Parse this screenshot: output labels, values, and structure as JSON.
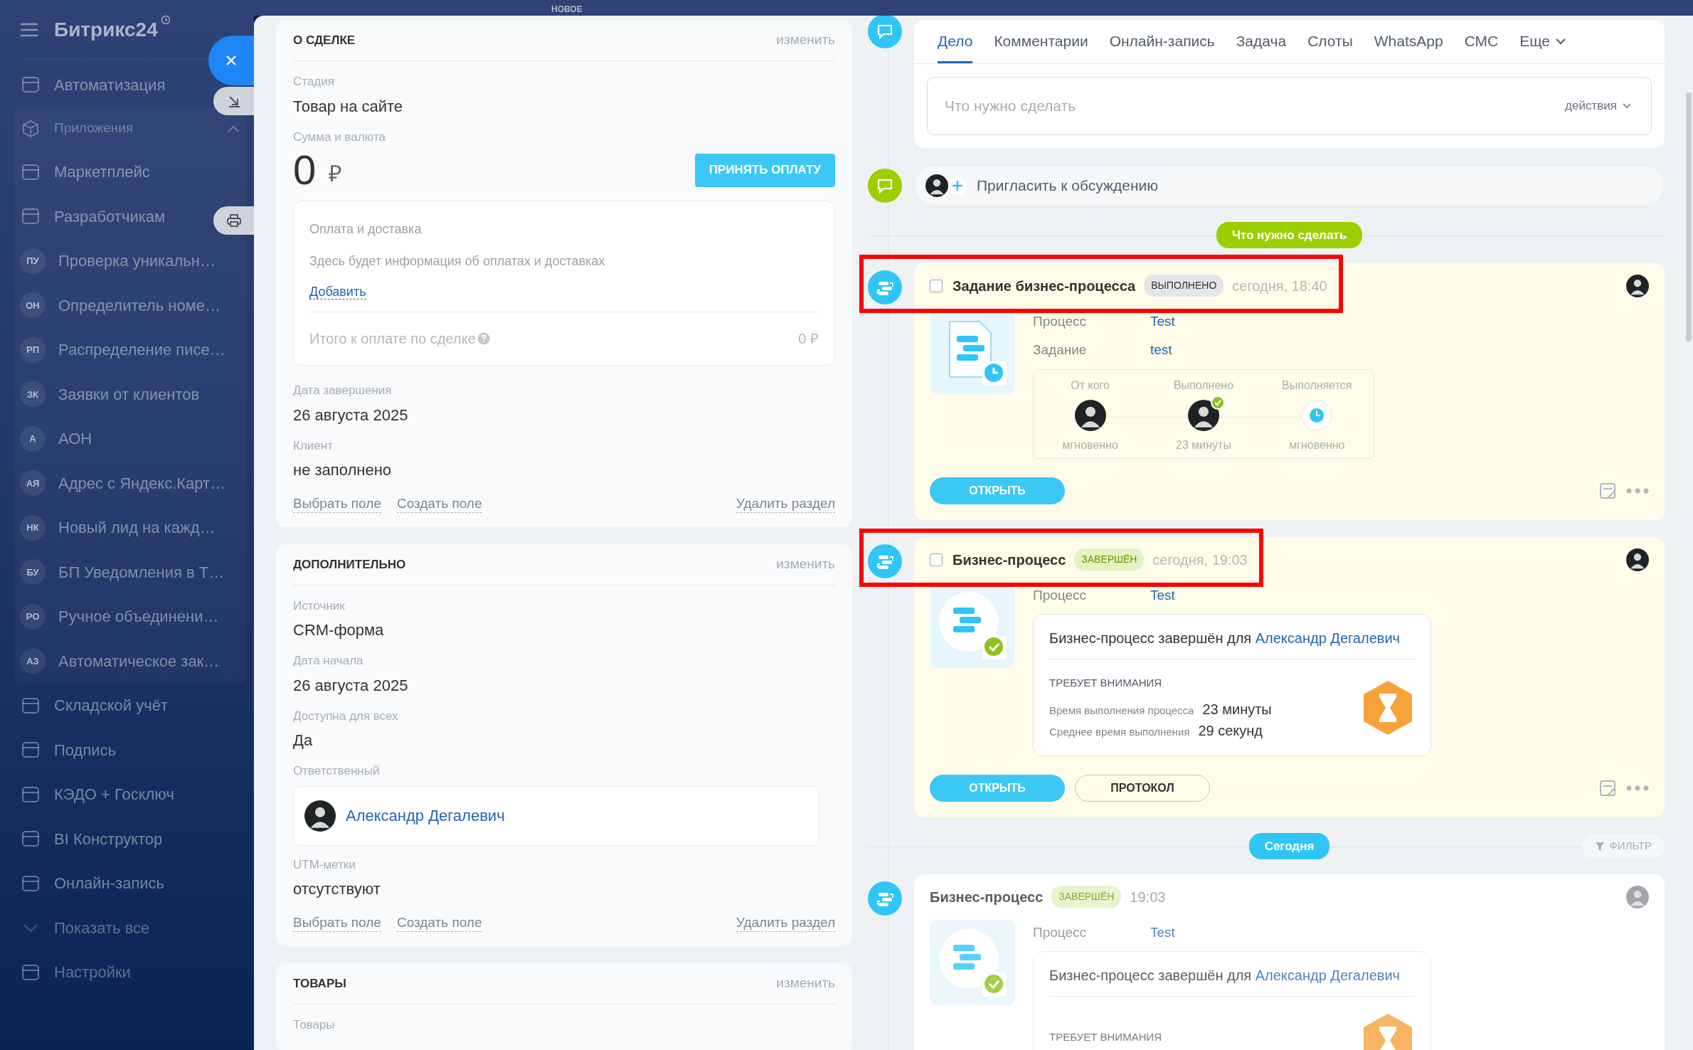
{
  "sidebar": {
    "logo": "Битрикс24",
    "items": [
      {
        "kind": "icon",
        "label": "Автоматизация"
      },
      {
        "kind": "group",
        "label": "Приложения",
        "expanded": true,
        "children": [
          {
            "kind": "icon",
            "label": "Маркетплейс"
          },
          {
            "kind": "icon",
            "label": "Разработчикам"
          },
          {
            "kind": "initials",
            "initials": "ПУ",
            "label": "Проверка уникальн…"
          },
          {
            "kind": "initials",
            "initials": "ОН",
            "label": "Определитель номе…"
          },
          {
            "kind": "initials",
            "initials": "РП",
            "label": "Распределение писе…"
          },
          {
            "kind": "initials",
            "initials": "ЗК",
            "label": "Заявки от клиентов"
          },
          {
            "kind": "initials",
            "initials": "А",
            "label": "АОН"
          },
          {
            "kind": "initials",
            "initials": "АЯ",
            "label": "Адрес с Яндекс.Карт…"
          },
          {
            "kind": "initials",
            "initials": "НК",
            "label": "Новый лид на кажд…"
          },
          {
            "kind": "initials",
            "initials": "БУ",
            "label": "БП Уведомления в Т…"
          },
          {
            "kind": "initials",
            "initials": "РО",
            "label": "Ручное объединени…"
          },
          {
            "kind": "initials",
            "initials": "АЗ",
            "label": "Автоматическое зак…"
          }
        ]
      },
      {
        "kind": "icon",
        "label": "Складской учёт"
      },
      {
        "kind": "icon",
        "label": "Подпись"
      },
      {
        "kind": "icon",
        "label": "КЭДО + Госключ"
      },
      {
        "kind": "icon",
        "label": "BI Конструктор"
      },
      {
        "kind": "icon",
        "label": "Онлайн-запись"
      },
      {
        "kind": "more",
        "label": "Показать все"
      },
      {
        "kind": "icon",
        "label": "Настройки"
      }
    ]
  },
  "top_bar": {
    "label": "НОВОЕ"
  },
  "sections": [
    {
      "title": "О СДЕЛКЕ",
      "edit": "изменить",
      "fields": [
        {
          "kind": "text",
          "label": "Стадия",
          "value": "Товар на сайте"
        },
        {
          "kind": "money",
          "label": "Сумма и валюта",
          "amount": "0",
          "currency": "₽",
          "button": "ПРИНЯТЬ ОПЛАТУ"
        },
        {
          "kind": "payment",
          "title": "Оплата и доставка",
          "text": "Здесь будет информация об оплатах и доставках",
          "link": "Добавить",
          "total_label": "Итого к оплате по сделке",
          "total": "0 ₽"
        },
        {
          "kind": "text",
          "label": "Дата завершения",
          "value": "26 августа 2025"
        },
        {
          "kind": "text",
          "label": "Клиент",
          "value": "не заполнено"
        }
      ],
      "actions": [
        "Выбрать поле",
        "Создать поле"
      ],
      "delete": "Удалить раздел"
    },
    {
      "title": "ДОПОЛНИТЕЛЬНО",
      "edit": "изменить",
      "fields": [
        {
          "kind": "text",
          "label": "Источник",
          "value": "CRM-форма"
        },
        {
          "kind": "text",
          "label": "Дата начала",
          "value": "26 августа 2025"
        },
        {
          "kind": "text",
          "label": "Доступна для всех",
          "value": "Да"
        },
        {
          "kind": "person",
          "label": "Ответственный",
          "value": "Александр Дегалевич"
        },
        {
          "kind": "text",
          "label": "UTM-метки",
          "value": "отсутствуют"
        }
      ],
      "actions": [
        "Выбрать поле",
        "Создать поле"
      ],
      "delete": "Удалить раздел"
    },
    {
      "title": "ТОВАРЫ",
      "edit": "изменить",
      "fields": [
        {
          "kind": "text",
          "label": "Товары"
        }
      ]
    }
  ],
  "timeline": {
    "tabs": [
      {
        "label": "Дело",
        "selected": true
      },
      {
        "label": "Комментарии",
        "selected": false
      },
      {
        "label": "Онлайн-запись",
        "selected": false
      },
      {
        "label": "Задача",
        "selected": false
      },
      {
        "label": "Слоты",
        "selected": false
      },
      {
        "label": "WhatsApp",
        "selected": false
      },
      {
        "label": "СМС",
        "selected": false
      },
      {
        "label": "Еще",
        "selected": false,
        "kind": "more"
      }
    ],
    "composer": {
      "placeholder": "Что нужно сделать",
      "actions": "действия"
    },
    "invite": "Пригласить к обсуждению",
    "entries": [
      {
        "kind": "heading",
        "label": "Что нужно сделать"
      },
      {
        "kind": "task",
        "highlighted": true,
        "checked": false,
        "title": "Задание бизнес-процесса",
        "badge": "ВЫПОЛНЕНО",
        "time": "сегодня, 18:40",
        "fields": [
          {
            "label": "Процесс",
            "value": "Test"
          },
          {
            "label": "Задание",
            "value": "test"
          }
        ],
        "steps": [
          {
            "label": "От кого",
            "kind": "person",
            "time": "мгновенно"
          },
          {
            "label": "Выполнено",
            "kind": "person-done",
            "time": "23 минуты"
          },
          {
            "label": "Выполняется",
            "kind": "waiting",
            "time": "мгновенно"
          }
        ],
        "buttons": [
          {
            "label": "ОТКРЫТЬ",
            "kind": "primary"
          }
        ]
      },
      {
        "kind": "process",
        "highlighted": true,
        "checked": false,
        "title": "Бизнес-процесс",
        "badge": "ЗАВЕРШЁН",
        "time": "сегодня, 19:03",
        "fields": [
          {
            "label": "Процесс",
            "value": "Test"
          }
        ],
        "summary": {
          "text": "Бизнес-процесс завершён для",
          "link": "Александр Дегалевич",
          "attention": "ТРЕБУЕТ ВНИМАНИЯ",
          "stats": [
            {
              "label": "Время выполнения процесса",
              "value": "23 минуты"
            },
            {
              "label": "Среднее время выполнения",
              "value": "29 секунд"
            }
          ]
        },
        "buttons": [
          {
            "label": "ОТКРЫТЬ",
            "kind": "primary"
          },
          {
            "label": "ПРОТОКОЛ",
            "kind": "outline"
          }
        ]
      },
      {
        "kind": "date",
        "label": "Сегодня",
        "filter": "ФИЛЬТР"
      },
      {
        "kind": "history",
        "highlighted": false,
        "title": "Бизнес-процесс",
        "badge": "ЗАВЕРШЁН",
        "time": "19:03",
        "fields": [
          {
            "label": "Процесс",
            "value": "Test"
          }
        ],
        "summary": {
          "text": "Бизнес-процесс завершён для",
          "link": "Александр Дегалевич",
          "attention": "ТРЕБУЕТ ВНИМАНИЯ"
        }
      }
    ]
  }
}
